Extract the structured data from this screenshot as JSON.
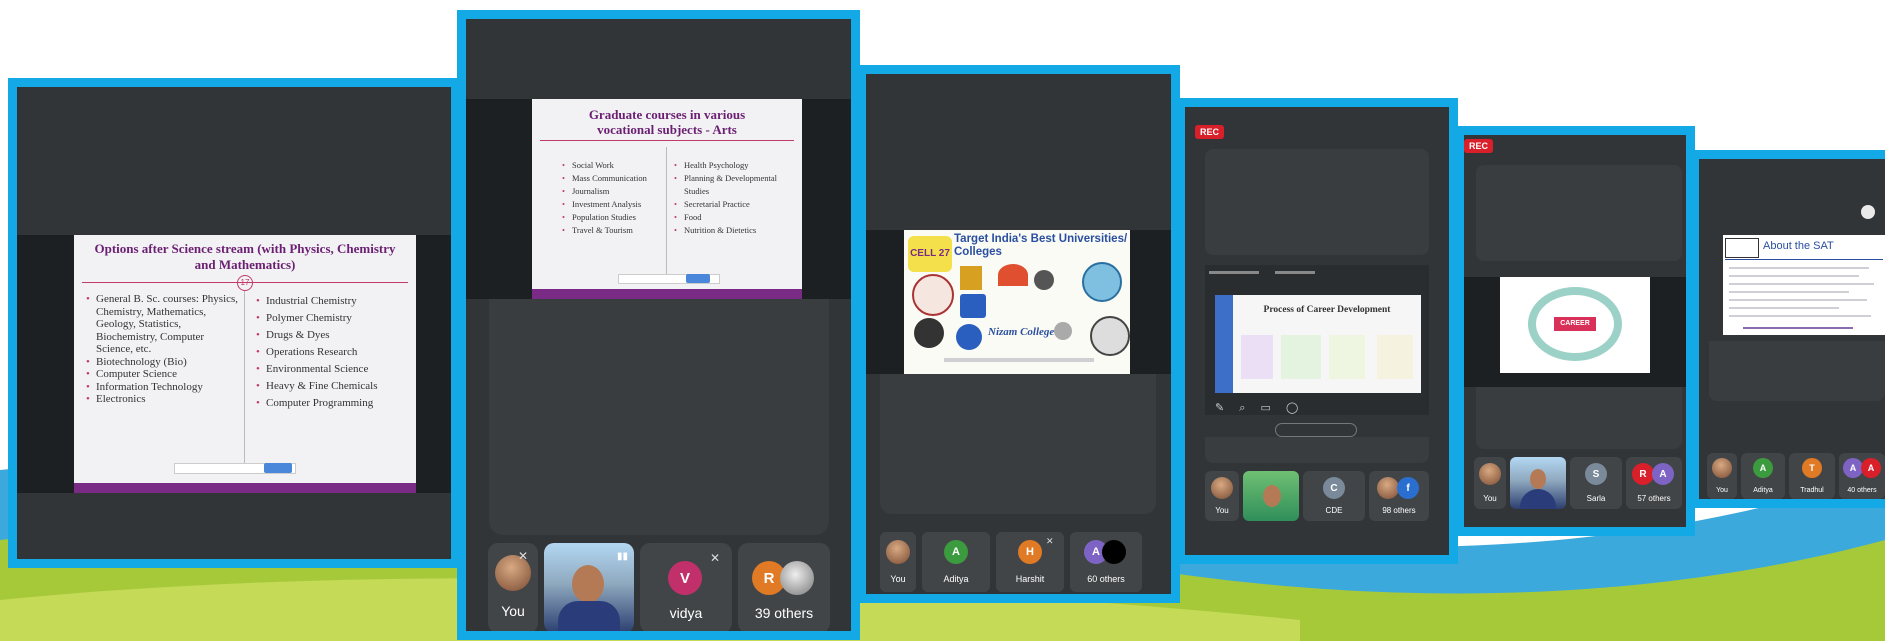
{
  "panels": {
    "p1": {
      "slide_title": "Options after Science stream (with Physics, Chemistry and Mathematics)",
      "slide_number": "17",
      "left_items": [
        "General B. Sc. courses: Physics, Chemistry, Mathematics, Geology, Statistics, Biochemistry, Computer Science, etc.",
        "Biotechnology (Bio)",
        "Computer Science",
        "Information Technology",
        "Electronics"
      ],
      "right_items": [
        "Industrial Chemistry",
        "Polymer Chemistry",
        "Drugs & Dyes",
        "Operations Research",
        "Environmental Science",
        "Heavy & Fine Chemicals",
        "Computer Programming"
      ]
    },
    "p2": {
      "slide_title": "Graduate courses in various vocational subjects - Arts",
      "left_items": [
        "Social Work",
        "Mass Communication",
        "Journalism",
        "Investment Analysis",
        "Population Studies",
        "Travel & Tourism"
      ],
      "right_items": [
        "Health Psychology",
        "Planning & Developmental Studies",
        "Secretarial Practice",
        "Food",
        "Nutrition & Dietetics"
      ],
      "participants": {
        "you": "You",
        "vidya_initial": "V",
        "vidya": "vidya",
        "r_initial": "R",
        "others": "39 others"
      }
    },
    "p3": {
      "slide_title": "Target India's Best Universities/ Colleges",
      "college_name": "Nizam College",
      "logo_text": "CELL 27",
      "participants": {
        "you": "You",
        "a_initial": "A",
        "aditya": "Aditya",
        "h_initial": "H",
        "harshit": "Harshit",
        "others_initial": "A",
        "others": "60 others"
      }
    },
    "p4": {
      "rec": "REC",
      "slide_title": "Process of Career Development",
      "participants": {
        "you": "You",
        "c_initial": "C",
        "cde": "CDE",
        "f_initial": "f",
        "others": "98 others"
      }
    },
    "p5": {
      "rec": "REC",
      "center_label": "CAREER",
      "participants": {
        "you": "You",
        "s_initial": "S",
        "sarla": "Sarla",
        "r_initial": "R",
        "a_initial": "A",
        "others": "57 others"
      }
    },
    "p6": {
      "slide_title": "About the SAT",
      "participants": {
        "you": "You",
        "a_initial": "A",
        "aditya": "Aditya",
        "t_initial": "T",
        "tradhul": "Tradhul",
        "others_a": "A",
        "others_b": "A",
        "others": "40 others"
      }
    }
  },
  "colors": {
    "frame": "#13a8e6",
    "call_bg": "#323538",
    "tile_bg": "#424548",
    "slide_title": "#6b1f72",
    "bullet": "#c23a6d",
    "rec": "#d9202a",
    "avatar_green": "#3c9b3e",
    "avatar_orange": "#e07a24",
    "avatar_purple": "#7d64c4",
    "avatar_pink": "#c2306b",
    "swoosh_green": "#a6c93a",
    "swoosh_blue": "#1a9ad6"
  }
}
